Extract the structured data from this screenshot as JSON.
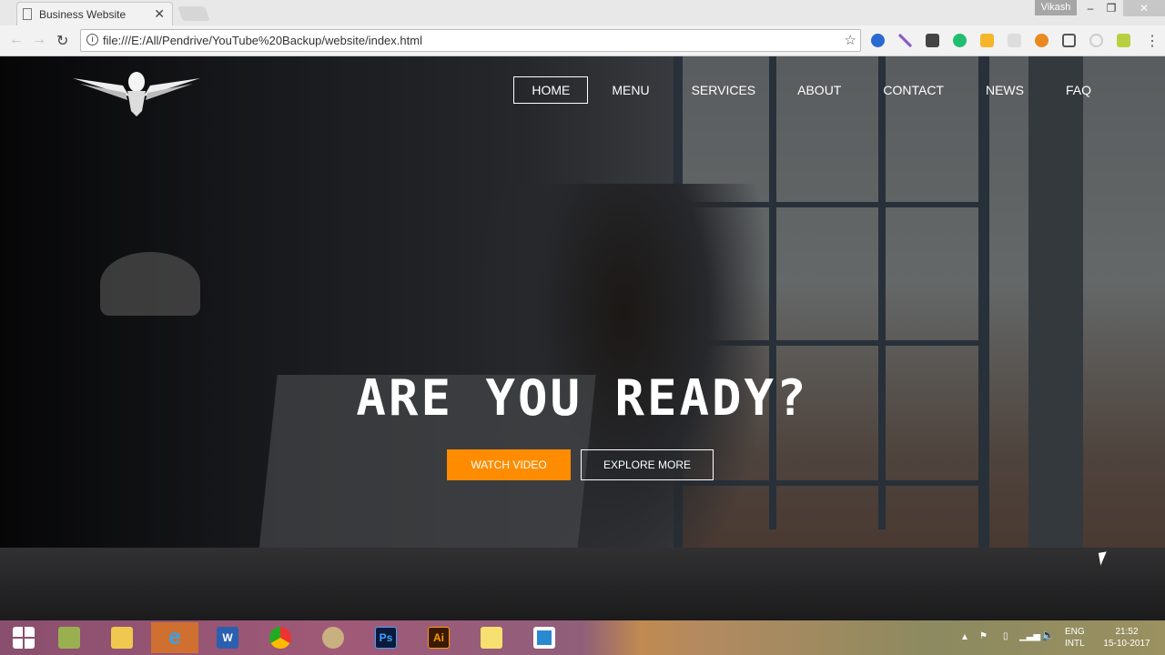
{
  "browser": {
    "tab_title": "Business Website",
    "url": "file:///E:/All/Pendrive/YouTube%20Backup/website/index.html",
    "user": "Vikash",
    "extensions": [
      "honey-icon",
      "pen-icon",
      "m-icon",
      "grammarly-icon",
      "bell-icon",
      "link-icon",
      "50-icon",
      "cast-icon",
      "shield-icon",
      "yl-icon"
    ]
  },
  "site": {
    "nav": [
      {
        "label": "HOME",
        "active": true
      },
      {
        "label": "MENU"
      },
      {
        "label": "SERVICES"
      },
      {
        "label": "ABOUT"
      },
      {
        "label": "CONTACT"
      },
      {
        "label": "NEWS"
      },
      {
        "label": "FAQ"
      }
    ],
    "hero_title": "ARE YOU READY?",
    "primary_button": "WATCH VIDEO",
    "secondary_button": "EXPLORE MORE",
    "accent": "#ff8c00"
  },
  "taskbar": {
    "apps": [
      "start",
      "maps",
      "file-explorer",
      "internet-explorer",
      "word",
      "chrome",
      "paint",
      "photoshop",
      "illustrator",
      "sticky-notes",
      "brackets"
    ],
    "ps_label": "Ps",
    "ai_label": "Ai",
    "lang1": "ENG",
    "lang2": "INTL",
    "time": "21:52",
    "date": "15-10-2017"
  }
}
